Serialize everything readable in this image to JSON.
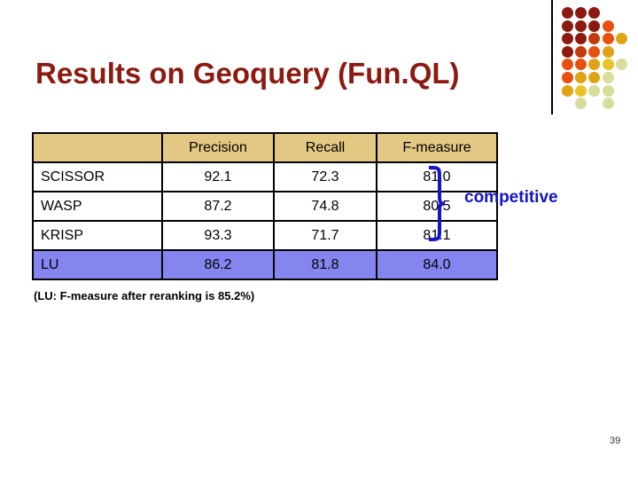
{
  "slide": {
    "title": "Results on Geoquery (Fun.QL)",
    "page_number": "39",
    "background_color": "#ffffff",
    "title_color": "#8C1A11"
  },
  "table": {
    "header_bg_color": "#E2C883",
    "highlight_bg_color": "#8585F0",
    "border_color": "#000000",
    "columns": [
      {
        "key": "system",
        "label": ""
      },
      {
        "key": "precision",
        "label": "Precision"
      },
      {
        "key": "recall",
        "label": "Recall"
      },
      {
        "key": "fmeasure",
        "label": "F-measure"
      }
    ],
    "rows": [
      {
        "system": "SCISSOR",
        "precision": "92.1",
        "recall": "72.3",
        "fmeasure": "81.0",
        "highlighted": false
      },
      {
        "system": "WASP",
        "precision": "87.2",
        "recall": "74.8",
        "fmeasure": "80.5",
        "highlighted": false
      },
      {
        "system": "KRISP",
        "precision": "93.3",
        "recall": "71.7",
        "fmeasure": "81.1",
        "highlighted": false
      },
      {
        "system": "LU",
        "precision": "86.2",
        "recall": "81.8",
        "fmeasure": "84.0",
        "highlighted": true
      }
    ]
  },
  "annotation": {
    "label": "competitive",
    "color": "#1414C8"
  },
  "footnote": {
    "text": "(LU: F-measure after reranking is 85.2%)"
  },
  "decoration": {
    "dot_colors": {
      "dark_red": "#8C1A11",
      "red": "#C33A10",
      "orange_red": "#E8500F",
      "orange": "#EE7711",
      "gold": "#DFA316",
      "yellow": "#E8C42A",
      "pale": "#D9DC9A"
    },
    "dots": [
      {
        "row": 0,
        "col": 0,
        "color": "#8C1A11"
      },
      {
        "row": 0,
        "col": 1,
        "color": "#8C1A11"
      },
      {
        "row": 0,
        "col": 2,
        "color": "#8C1A11"
      },
      {
        "row": 1,
        "col": 0,
        "color": "#8C1A11"
      },
      {
        "row": 1,
        "col": 1,
        "color": "#8C1A11"
      },
      {
        "row": 1,
        "col": 2,
        "color": "#8C1A11"
      },
      {
        "row": 1,
        "col": 3,
        "color": "#E8500F"
      },
      {
        "row": 2,
        "col": 0,
        "color": "#8C1A11"
      },
      {
        "row": 2,
        "col": 1,
        "color": "#8C1A11"
      },
      {
        "row": 2,
        "col": 2,
        "color": "#C33A10"
      },
      {
        "row": 2,
        "col": 3,
        "color": "#E8500F"
      },
      {
        "row": 2,
        "col": 4,
        "color": "#DFA316"
      },
      {
        "row": 3,
        "col": 0,
        "color": "#8C1A11"
      },
      {
        "row": 3,
        "col": 1,
        "color": "#C33A10"
      },
      {
        "row": 3,
        "col": 2,
        "color": "#E8500F"
      },
      {
        "row": 3,
        "col": 3,
        "color": "#DFA316"
      },
      {
        "row": 4,
        "col": 0,
        "color": "#E8500F"
      },
      {
        "row": 4,
        "col": 1,
        "color": "#E8500F"
      },
      {
        "row": 4,
        "col": 2,
        "color": "#DFA316"
      },
      {
        "row": 4,
        "col": 3,
        "color": "#E8C42A"
      },
      {
        "row": 4,
        "col": 4,
        "color": "#D9DC9A"
      },
      {
        "row": 5,
        "col": 0,
        "color": "#E8500F"
      },
      {
        "row": 5,
        "col": 1,
        "color": "#DFA316"
      },
      {
        "row": 5,
        "col": 2,
        "color": "#DFA316"
      },
      {
        "row": 5,
        "col": 3,
        "color": "#D9DC9A"
      },
      {
        "row": 6,
        "col": 0,
        "color": "#DFA316"
      },
      {
        "row": 6,
        "col": 1,
        "color": "#E8C42A"
      },
      {
        "row": 6,
        "col": 2,
        "color": "#D9DC9A"
      },
      {
        "row": 6,
        "col": 3,
        "color": "#D9DC9A"
      },
      {
        "row": 7,
        "col": 1,
        "color": "#D9DC9A"
      },
      {
        "row": 7,
        "col": 3,
        "color": "#D9DC9A"
      }
    ]
  }
}
